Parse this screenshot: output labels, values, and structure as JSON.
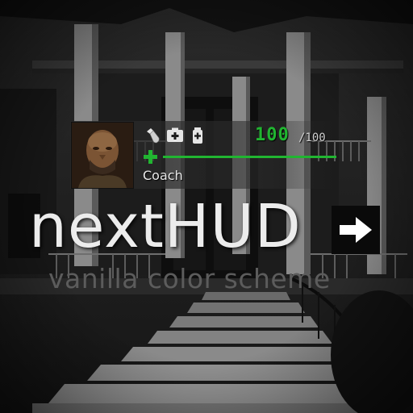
{
  "hud": {
    "character_name": "Coach",
    "health_value": "100",
    "health_max": "/100",
    "health_fraction": 1.0,
    "inventory_icons": [
      "pills-bottle-icon",
      "medkit-icon",
      "adrenaline-icon"
    ],
    "health_icon": "health-cross-icon",
    "colors": {
      "health": "#21b531",
      "text": "#e8e8e8"
    }
  },
  "logo": {
    "title": "nextHUD",
    "subtitle": "vanilla color scheme",
    "arrow_icon": "arrow-right-icon"
  }
}
